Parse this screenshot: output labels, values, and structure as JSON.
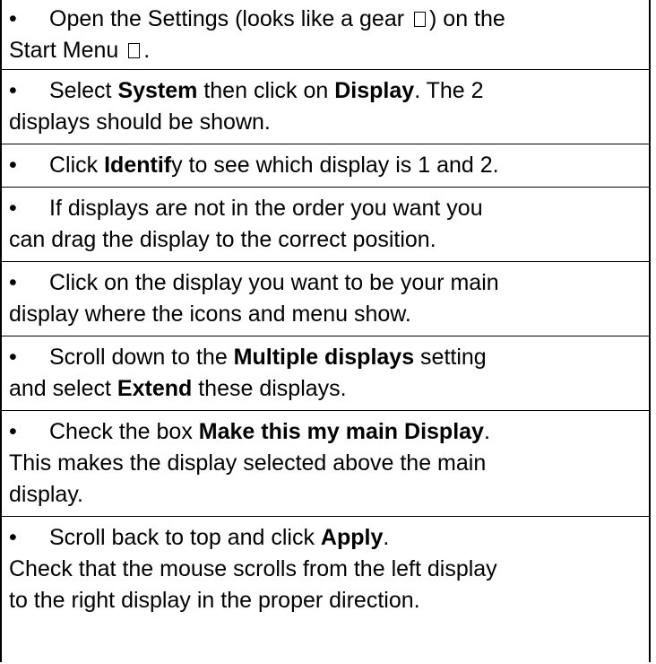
{
  "bullet_char": "•",
  "items": [
    {
      "l1a": "Open the Settings (looks like a gear ",
      "l1b": ") on the",
      "l2a": "Start Menu ",
      "l2b": "."
    },
    {
      "a": "Select ",
      "b": "System",
      "c": " then click on ",
      "d": "Display",
      "e": ". The 2",
      "l2": "displays should be shown."
    },
    {
      "a": "Click ",
      "b": "Identif",
      "c": "y to see which display is 1 and 2."
    },
    {
      "l1": "If displays are not in the order you want you",
      "l2": "can drag the display to the correct position."
    },
    {
      "l1": "Click on the display you want to be your main",
      "l2": "display where the icons and menu show."
    },
    {
      "a": "Scroll down to the ",
      "b": "Multiple displays",
      "c": " setting",
      "l2a": "and select ",
      "l2b": "Extend",
      "l2c": " these displays."
    },
    {
      "a": "Check the box ",
      "b": "Make this my main Display",
      "c": ".",
      "l2": "This makes the display selected above the main",
      "l3": "display."
    },
    {
      "a": "Scroll back to top and click ",
      "b": "Apply",
      "c": ".",
      "l2": "Check that the mouse scrolls from the left display",
      "l3": "to the right display in the proper direction."
    }
  ],
  "icons": {
    "gear": "gear-icon",
    "start_menu": "start-menu-icon"
  }
}
